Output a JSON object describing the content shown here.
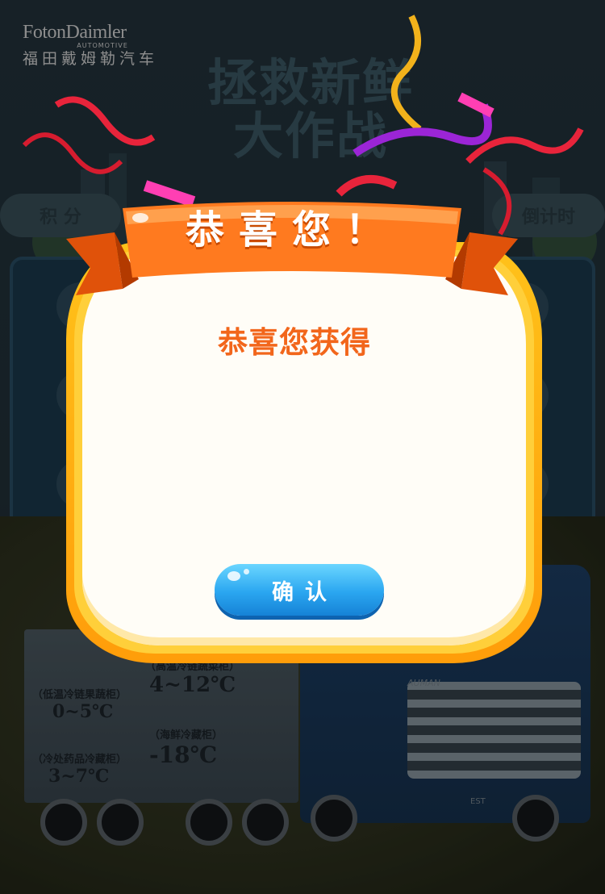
{
  "brand": {
    "name_en": "FotonDaimler",
    "sub_en": "AUTOMOTIVE",
    "name_cn": "福田戴姆勒汽车"
  },
  "background": {
    "title_line1": "拯救新鲜",
    "title_line2": "大作战",
    "left_pill": "积 分",
    "right_pill": "倒计时",
    "truck_labels": [
      {
        "label": "（低温冷链果蔬柜）",
        "value": "0~5℃"
      },
      {
        "label": "（高温冷链蔬菜柜）",
        "value": "4~12℃"
      },
      {
        "label": "（冷处药品冷藏柜）",
        "value": "3~7℃"
      },
      {
        "label": "（海鲜冷藏柜）",
        "value": "-18℃"
      }
    ],
    "cab_brand": "AUMAN",
    "cab_model": "EST"
  },
  "dialog": {
    "title": "恭喜您！",
    "message": "恭喜您获得",
    "prize": "",
    "confirm_label": "确认"
  },
  "colors": {
    "accent_orange": "#f2661b",
    "frame_yellow": "#ffc21a",
    "button_blue": "#2aa6f0"
  }
}
